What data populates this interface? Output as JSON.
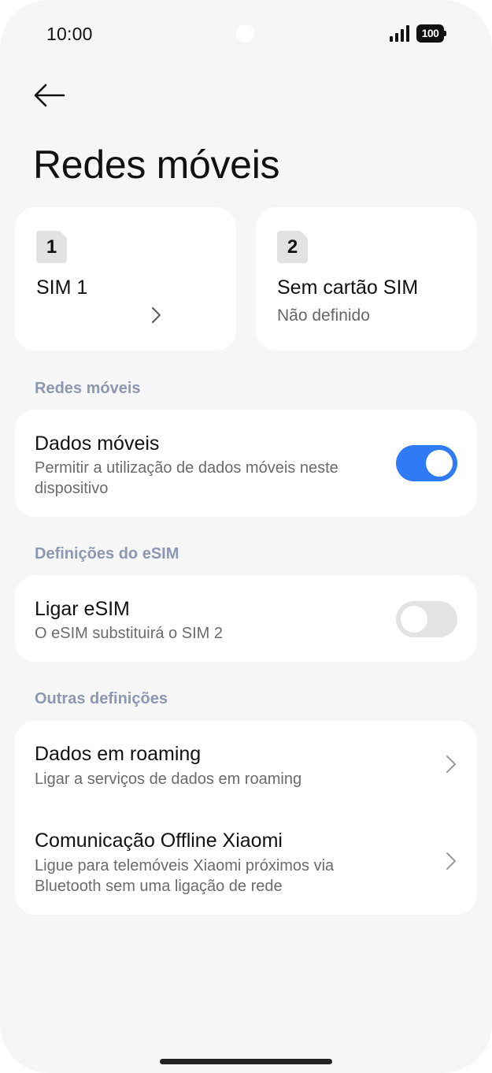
{
  "status_bar": {
    "time": "10:00",
    "battery": "100",
    "icons": [
      "signal-icon",
      "battery-icon"
    ]
  },
  "header": {
    "back_icon": "arrow-left-icon",
    "title": "Redes móveis"
  },
  "sims": [
    {
      "slot": "1",
      "name": "SIM 1",
      "subtitle": "",
      "icon": "chevron-right-icon"
    },
    {
      "slot": "2",
      "name": "Sem cartão SIM",
      "subtitle": "Não definido"
    }
  ],
  "sections": {
    "mobile_networks": {
      "header": "Redes móveis",
      "mobile_data": {
        "title": "Dados móveis",
        "subtitle_line1": "Permitir a utilização de dados móveis neste",
        "subtitle_line2": "dispositivo",
        "enabled": true
      }
    },
    "esim": {
      "header": "Definições do eSIM",
      "enable_esim": {
        "title": "Ligar eSIM",
        "subtitle": "O eSIM substituirá o SIM 2",
        "enabled": false
      }
    },
    "other": {
      "header": "Outras definições",
      "roaming": {
        "title": "Dados em roaming",
        "subtitle": "Ligar a serviços de dados em roaming"
      },
      "offline": {
        "title": "Comunicação Offline Xiaomi",
        "subtitle_line1": "Ligue para telemóveis Xiaomi próximos via",
        "subtitle_line2": "Bluetooth sem uma ligação de rede"
      }
    }
  },
  "colors": {
    "accent": "#2f7bf5",
    "section_header": "#8d97b0",
    "background": "#f6f6f6",
    "card": "#ffffff"
  }
}
